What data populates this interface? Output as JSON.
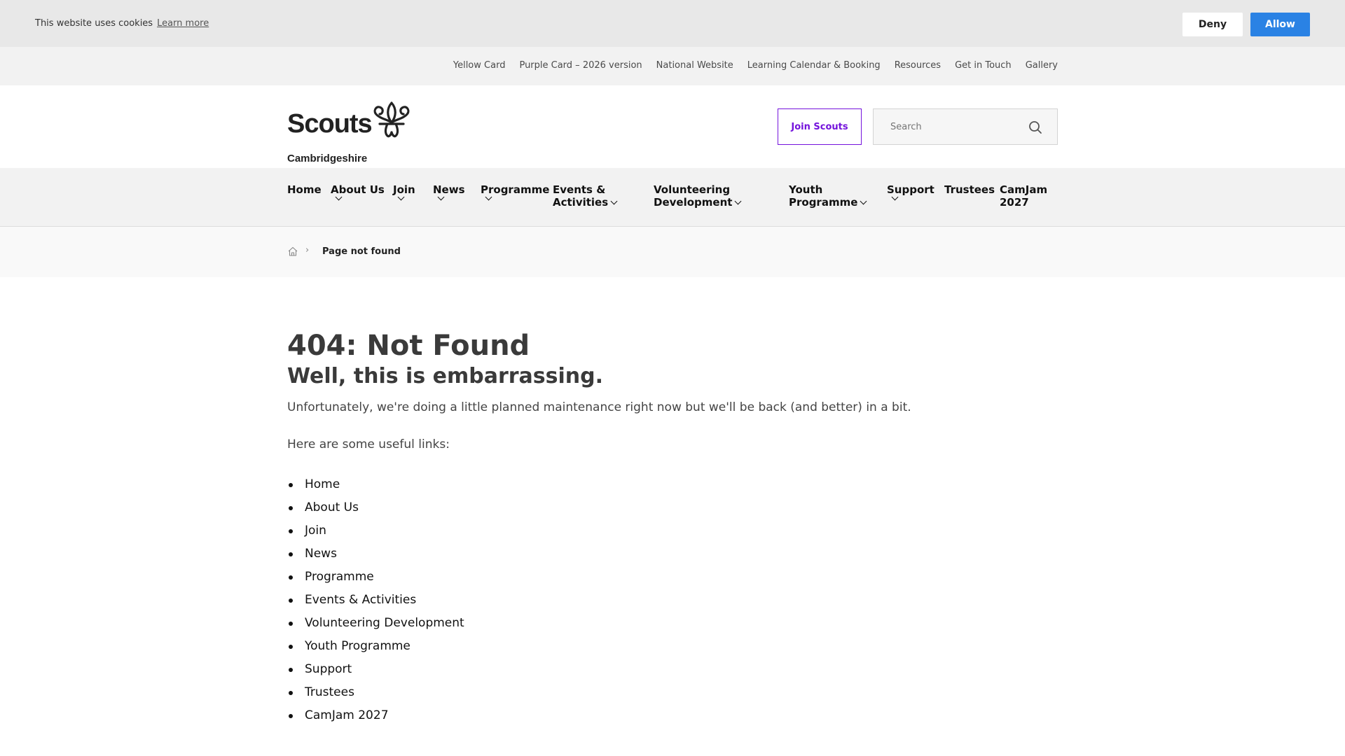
{
  "cookie": {
    "text": "This website uses cookies",
    "learn_more": "Learn more",
    "deny": "Deny",
    "allow": "Allow"
  },
  "utility_nav": [
    "Yellow Card",
    "Purple Card – 2026 version",
    "National Website",
    "Learning Calendar & Booking",
    "Resources",
    "Get in Touch",
    "Gallery"
  ],
  "header": {
    "logo_word": "Scouts",
    "logo_sub": "Cambridgeshire",
    "join_label": "Join Scouts",
    "search_placeholder": "Search"
  },
  "main_nav": [
    {
      "line1": "Home",
      "line2": "",
      "dropdown": false
    },
    {
      "line1": "About Us",
      "line2": "",
      "dropdown": true
    },
    {
      "line1": "Join",
      "line2": "",
      "dropdown": true
    },
    {
      "line1": "News",
      "line2": "",
      "dropdown": true
    },
    {
      "line1": "Programme",
      "line2": "",
      "dropdown": true
    },
    {
      "line1": "Events &",
      "line2": "Activities",
      "dropdown": true
    },
    {
      "line1": "Volunteering",
      "line2": "Development",
      "dropdown": true
    },
    {
      "line1": "Youth",
      "line2": "Programme",
      "dropdown": true
    },
    {
      "line1": "Support",
      "line2": "",
      "dropdown": true
    },
    {
      "line1": "Trustees",
      "line2": "",
      "dropdown": false
    },
    {
      "line1": "CamJam",
      "line2": "2027",
      "dropdown": false
    }
  ],
  "breadcrumb": {
    "current": "Page not found"
  },
  "content": {
    "title": "404: Not Found",
    "subtitle": "Well, this is embarrassing.",
    "message": "Unfortunately, we're doing a little planned maintenance right now but we'll be back (and better) in a bit.",
    "links_intro": "Here are some useful links:",
    "links": [
      "Home",
      "About Us",
      "Join",
      "News",
      "Programme",
      "Events & Activities",
      "Volunteering Development",
      "Youth Programme",
      "Support",
      "Trustees",
      "CamJam 2027"
    ]
  },
  "colors": {
    "brand_purple": "#7413dc",
    "allow_blue": "#2a82e4"
  }
}
